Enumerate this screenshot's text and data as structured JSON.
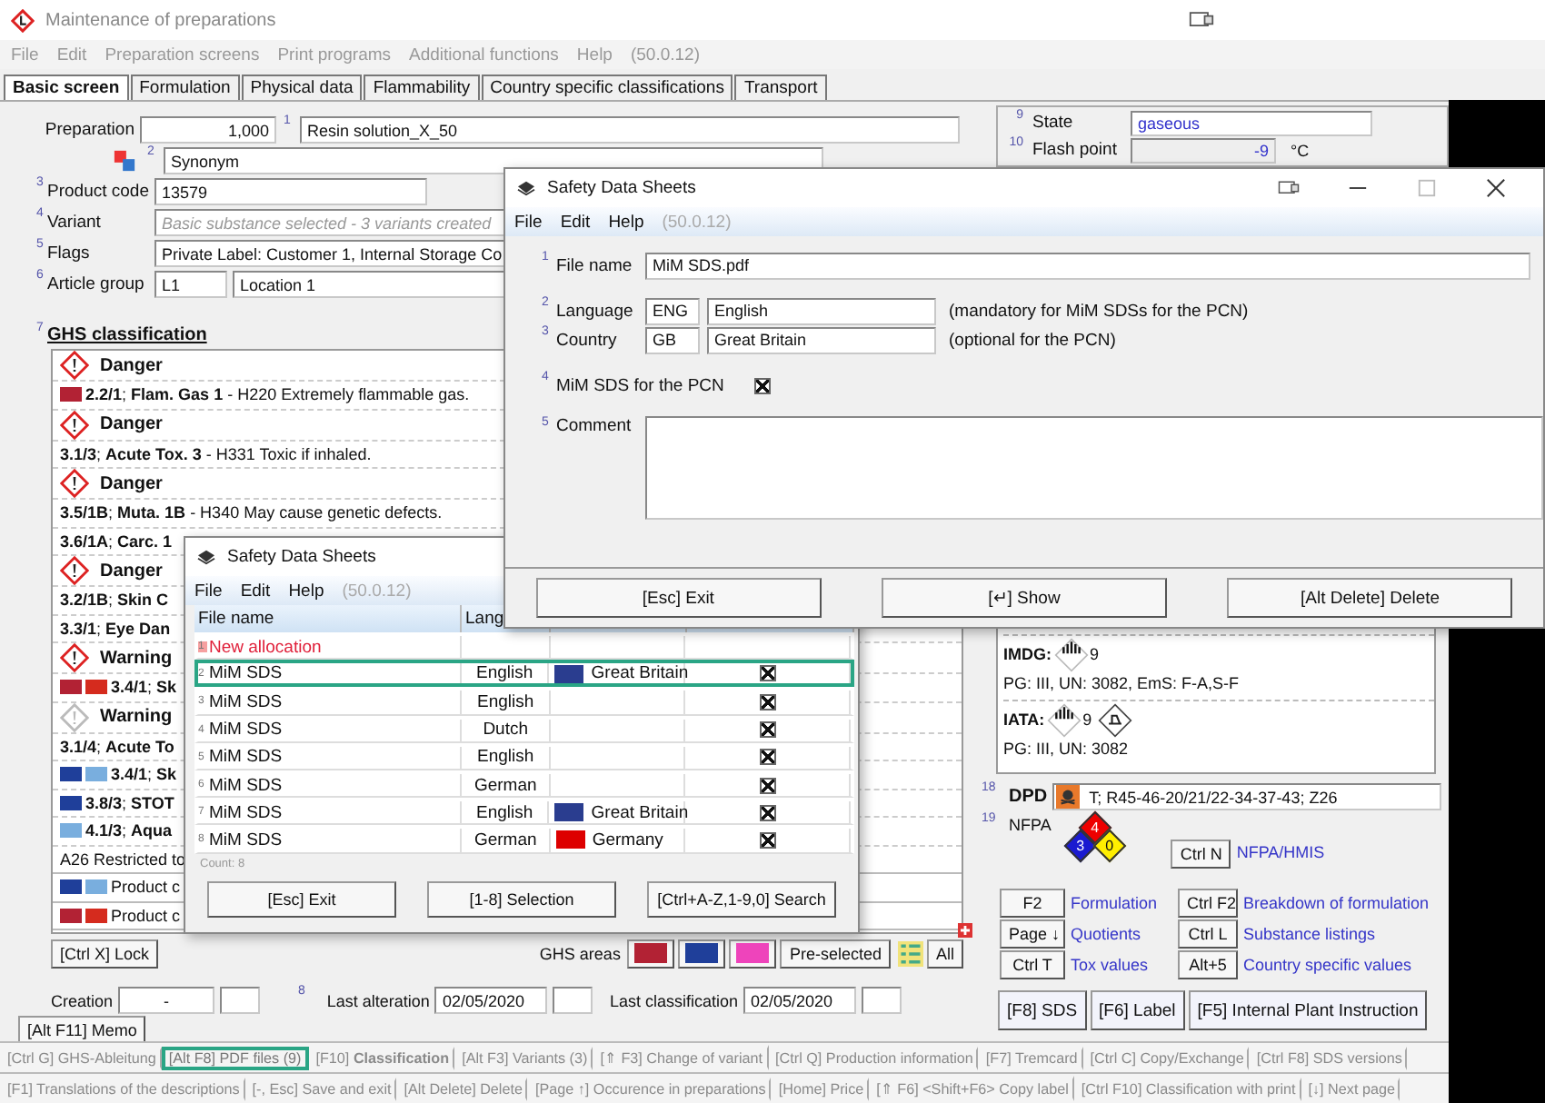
{
  "main_window": {
    "title": "Maintenance of preparations"
  },
  "menu": {
    "items": [
      "File",
      "Edit",
      "Preparation screens",
      "Print programs",
      "Additional functions",
      "Help"
    ],
    "version": "(50.0.12)"
  },
  "tabs": [
    {
      "label": "Basic screen",
      "selected": true
    },
    {
      "label": "Formulation",
      "selected": false
    },
    {
      "label": "Physical data",
      "selected": false
    },
    {
      "label": "Flammability",
      "selected": false
    },
    {
      "label": "Country specific classifications",
      "selected": false
    },
    {
      "label": "Transport",
      "selected": false
    }
  ],
  "preparation": {
    "label": "Preparation",
    "number": "1,000",
    "names": [
      {
        "no": "1",
        "value": "Resin solution_X_50"
      },
      {
        "no": "2",
        "value": "Synonym"
      }
    ]
  },
  "fields": [
    {
      "no": "3",
      "label": "Product code",
      "kind": "text",
      "values": [
        "13579"
      ]
    },
    {
      "no": "4",
      "label": "Variant",
      "kind": "info",
      "values": [
        "Basic substance selected - 3 variants created"
      ]
    },
    {
      "no": "5",
      "label": "Flags",
      "kind": "text",
      "values": [
        "Private Label: Customer 1, Internal Storage Co"
      ]
    },
    {
      "no": "6",
      "label": "Article group",
      "kind": "pair",
      "values": [
        "L1",
        "Location 1"
      ]
    }
  ],
  "ghs": {
    "no": "7",
    "title": "GHS classification",
    "rows": [
      {
        "kind": "signal",
        "word": "Danger",
        "greyed": false
      },
      {
        "kind": "statement",
        "flags": [
          {
            "color": "#b22234"
          }
        ],
        "text": "**2.2/1**; **Flam. Gas 1** - H220 Extremely flammable gas."
      },
      {
        "kind": "signal",
        "word": "Danger",
        "greyed": false
      },
      {
        "kind": "statement",
        "flags": [],
        "text": "**3.1/3**; **Acute Tox. 3** - H331 Toxic if inhaled."
      },
      {
        "kind": "signal",
        "word": "Danger",
        "greyed": false
      },
      {
        "kind": "statement",
        "flags": [],
        "text": "**3.5/1B**; **Muta. 1B** - H340 May cause genetic defects."
      },
      {
        "kind": "statement",
        "flags": [],
        "text": "**3.6/1A**; **Carc. 1**"
      },
      {
        "kind": "signal",
        "word": "Danger",
        "greyed": false
      },
      {
        "kind": "statement",
        "flags": [],
        "text": "**3.2/1B**; **Skin C**"
      },
      {
        "kind": "statement",
        "flags": [],
        "text": "**3.3/1**; **Eye Dan**"
      },
      {
        "kind": "signal",
        "word": "Warning",
        "greyed": false
      },
      {
        "kind": "statement",
        "flags": [
          {
            "color": "#b22234"
          },
          {
            "color": "#d52b1e"
          }
        ],
        "text": "**3.4/1**; **Sk**"
      },
      {
        "kind": "signal",
        "word": "Warning",
        "greyed": true
      },
      {
        "kind": "statement",
        "flags": [],
        "text": "**3.1/4**; **Acute To**"
      },
      {
        "kind": "statement",
        "flags": [
          {
            "color": "#1f3f9a"
          },
          {
            "color": "#79aede"
          }
        ],
        "text": "**3.4/1**; **Sk**"
      },
      {
        "kind": "statement",
        "flags": [
          {
            "color": "#1f3f9a"
          }
        ],
        "text": "**3.8/3**; **STOT**"
      },
      {
        "kind": "statement",
        "flags": [
          {
            "color": "#79aede"
          }
        ],
        "text": "**4.1/3**; **Aqua**"
      },
      {
        "kind": "note",
        "flags": [],
        "text": "A26 Restricted to"
      },
      {
        "kind": "note",
        "flags": [
          {
            "color": "#1f3f9a"
          },
          {
            "color": "#79aede"
          }
        ],
        "text": "Product c"
      },
      {
        "kind": "note",
        "flags": [
          {
            "color": "#b22234"
          },
          {
            "color": "#d52b1e"
          }
        ],
        "text": "Product c"
      }
    ]
  },
  "lock_button": "[Ctrl X] Lock",
  "ghs_areas": {
    "label": "GHS areas",
    "flags": [
      {
        "color": "#b22234"
      },
      {
        "color": "#1f3f9a"
      },
      {
        "color": "#ee44bb"
      }
    ],
    "preselected": "Pre-selected",
    "all": "All"
  },
  "dates": {
    "creation_label": "Creation",
    "creation": "-",
    "alteration_no": "8",
    "alteration_label": "Last alteration",
    "alteration": "02/05/2020",
    "classification_label": "Last classification",
    "classification": "02/05/2020"
  },
  "memo_button": "[Alt F11]  Memo",
  "properties": [
    {
      "no": "9",
      "label": "State",
      "value": "gaseous"
    },
    {
      "no": "10",
      "label": "Flash point",
      "value": "-9",
      "unit": "°C"
    }
  ],
  "transport": [
    {
      "mode": "IMDG:",
      "class": "9",
      "extra_icon": false,
      "details": "PG: III, UN: 3082, EmS: F-A,S-F"
    },
    {
      "mode": "IATA:",
      "class": "9",
      "extra_icon": true,
      "details": "PG: III, UN: 3082"
    }
  ],
  "dpd": {
    "no": "18",
    "label": "DPD",
    "value": "T; R45-46-20/21/22-34-37-43; Z26"
  },
  "nfpa": {
    "no": "19",
    "label": "NFPA",
    "health": "3",
    "flammability": "4",
    "reactivity": "0",
    "key": "Ctrl N",
    "link": "NFPA/HMIS"
  },
  "shortcuts": [
    {
      "key": "F2",
      "label": "Formulation"
    },
    {
      "key": "Ctrl F2",
      "label": "Breakdown of formulation"
    },
    {
      "key": "Page ↓",
      "label": "Quotients"
    },
    {
      "key": "Ctrl L",
      "label": "Substance listings"
    },
    {
      "key": "Ctrl T",
      "label": "Tox values"
    },
    {
      "key": "Alt+5",
      "label": "Country specific values"
    }
  ],
  "print_buttons": [
    "[F8] SDS",
    "[F6] Label",
    "[F5] Internal Plant Instruction"
  ],
  "toolbar_rows": [
    [
      {
        "label": "[Ctrl G] GHS-Ableitung",
        "highlighted": false
      },
      {
        "label": "[Alt F8] PDF files (9)",
        "highlighted": true
      },
      {
        "label": "[F10] **Classification**",
        "highlighted": false
      },
      {
        "label": "[Alt F3] Variants  (3)",
        "highlighted": false
      },
      {
        "label": "[⇑ F3] Change of variant",
        "highlighted": false
      },
      {
        "label": "[Ctrl Q] Production information",
        "highlighted": false
      },
      {
        "label": "[F7] Tremcard",
        "highlighted": false
      },
      {
        "label": "[Ctrl C] Copy/Exchange",
        "highlighted": false
      },
      {
        "label": "[Ctrl F8] SDS versions",
        "highlighted": false
      }
    ],
    [
      {
        "label": "[F1] Translations of the descriptions",
        "highlighted": false
      },
      {
        "label": "[-, Esc] Save and exit",
        "highlighted": false
      },
      {
        "label": "[Alt Delete] Delete",
        "highlighted": false
      },
      {
        "label": "[Page ↑] Occurence in preparations",
        "highlighted": false
      },
      {
        "label": "[Home] Price",
        "highlighted": false
      },
      {
        "label": "[⇑ F6] <Shift+F6> Copy label",
        "highlighted": false
      },
      {
        "label": "[Ctrl F10] Classification with print",
        "highlighted": false
      },
      {
        "label": "[↓] Next page",
        "highlighted": false
      }
    ]
  ],
  "sds_list": {
    "title": "Safety Data Sheets",
    "menu": [
      "File",
      "Edit",
      "Help"
    ],
    "version": "(50.0.12)",
    "columns": [
      "File name",
      "Lang"
    ],
    "rows": [
      {
        "no": "1",
        "kind": "new",
        "name": "New allocation",
        "highlighted": false
      },
      {
        "no": "2",
        "kind": "file",
        "name": "MiM SDS",
        "language": "English",
        "country": "Great Britain",
        "flag": {
          "color": "#2a3d8f"
        },
        "pcn": true,
        "highlighted": true
      },
      {
        "no": "3",
        "kind": "file",
        "name": "MiM SDS",
        "language": "English",
        "pcn": true,
        "highlighted": false
      },
      {
        "no": "4",
        "kind": "file",
        "name": "MiM SDS",
        "language": "Dutch",
        "pcn": true,
        "highlighted": false
      },
      {
        "no": "5",
        "kind": "file",
        "name": "MiM SDS",
        "language": "English",
        "pcn": true,
        "highlighted": false
      },
      {
        "no": "6",
        "kind": "file",
        "name": "MiM SDS",
        "language": "German",
        "pcn": true,
        "highlighted": false
      },
      {
        "no": "7",
        "kind": "file",
        "name": "MiM SDS",
        "language": "English",
        "country": "Great Britain",
        "flag": {
          "color": "#2a3d8f"
        },
        "pcn": true,
        "highlighted": false
      },
      {
        "no": "8",
        "kind": "file",
        "name": "MiM SDS",
        "language": "German",
        "country": "Germany",
        "flag": {
          "color": "#dd0000"
        },
        "pcn": true,
        "highlighted": false
      }
    ],
    "count": "Count: 8",
    "buttons": [
      "[Esc] Exit",
      "[1-8] Selection",
      "[Ctrl+A-Z,1-9,0] Search"
    ]
  },
  "sds_detail": {
    "title": "Safety Data Sheets",
    "menu": [
      "File",
      "Edit",
      "Help"
    ],
    "version": "(50.0.12)",
    "file_name": {
      "no": "1",
      "label": "File name",
      "value": "MiM SDS.pdf"
    },
    "language": {
      "no": "2",
      "label": "Language",
      "code": "ENG",
      "value": "English",
      "note": "(mandatory for MiM SDSs for the PCN)"
    },
    "country": {
      "no": "3",
      "label": "Country",
      "code": "GB",
      "value": "Great Britain",
      "note": "(optional for the PCN)"
    },
    "pcn": {
      "no": "4",
      "label": "MiM SDS for the PCN",
      "checked": true
    },
    "comment": {
      "no": "5",
      "label": "Comment"
    },
    "buttons": [
      "[Esc] Exit",
      "[↵] Show",
      "[Alt Delete] Delete"
    ]
  }
}
